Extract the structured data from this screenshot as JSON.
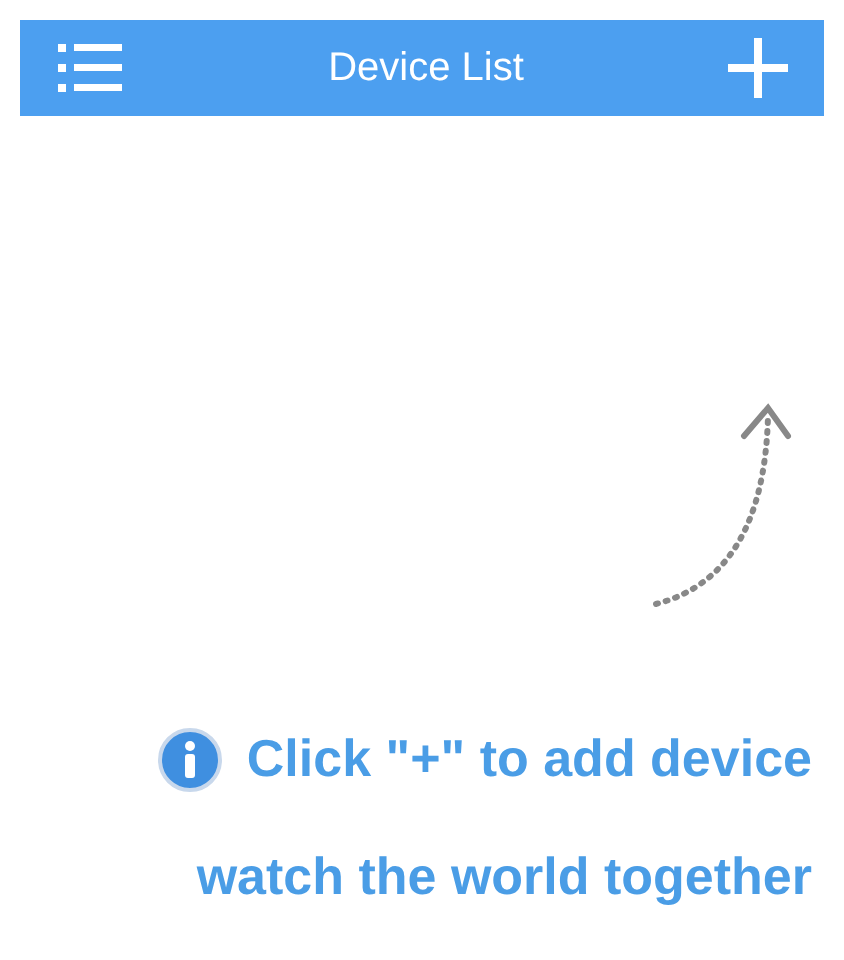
{
  "header": {
    "title": "Device List"
  },
  "hint": {
    "line_1": "Click \"+\" to add device",
    "line_2": "watch the world together"
  }
}
